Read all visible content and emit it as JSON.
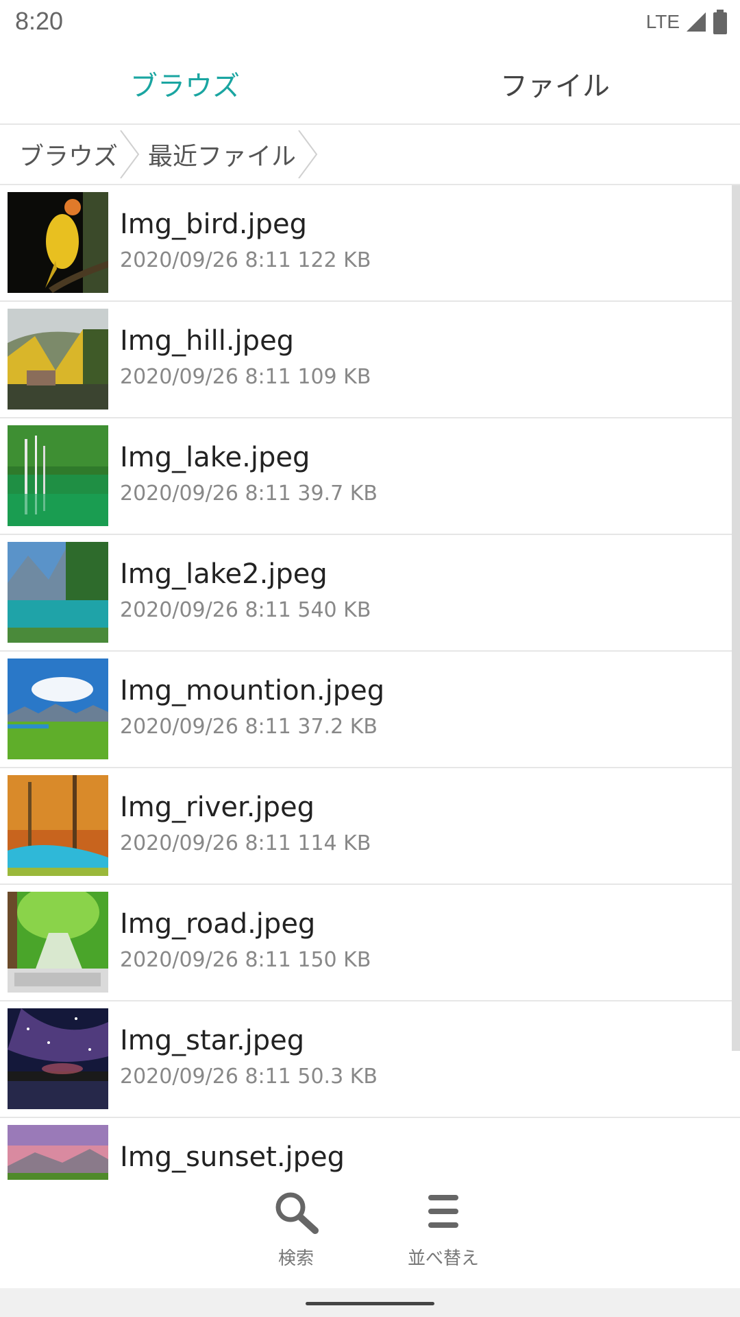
{
  "status_bar": {
    "time": "8:20",
    "network": "LTE"
  },
  "tabs": [
    {
      "label": "ブラウズ",
      "active": true
    },
    {
      "label": "ファイル",
      "active": false
    }
  ],
  "breadcrumb": [
    "ブラウズ",
    "最近ファイル"
  ],
  "files": [
    {
      "name": "Img_bird.jpeg",
      "date": "2020/09/26 8:11",
      "size": "122 KB"
    },
    {
      "name": "Img_hill.jpeg",
      "date": "2020/09/26 8:11",
      "size": "109 KB"
    },
    {
      "name": "Img_lake.jpeg",
      "date": "2020/09/26 8:11",
      "size": "39.7 KB"
    },
    {
      "name": "Img_lake2.jpeg",
      "date": "2020/09/26 8:11",
      "size": "540 KB"
    },
    {
      "name": "Img_mountion.jpeg",
      "date": "2020/09/26 8:11",
      "size": "37.2 KB"
    },
    {
      "name": "Img_river.jpeg",
      "date": "2020/09/26 8:11",
      "size": "114 KB"
    },
    {
      "name": "Img_road.jpeg",
      "date": "2020/09/26 8:11",
      "size": "150 KB"
    },
    {
      "name": "Img_star.jpeg",
      "date": "2020/09/26 8:11",
      "size": "50.3 KB"
    },
    {
      "name": "Img_sunset.jpeg"
    }
  ],
  "toolbar": {
    "search_label": "検索",
    "sort_label": "並べ替え"
  },
  "colors": {
    "accent": "#1aa5a1",
    "divider": "#e6e6e6",
    "meta_text": "#888888"
  }
}
